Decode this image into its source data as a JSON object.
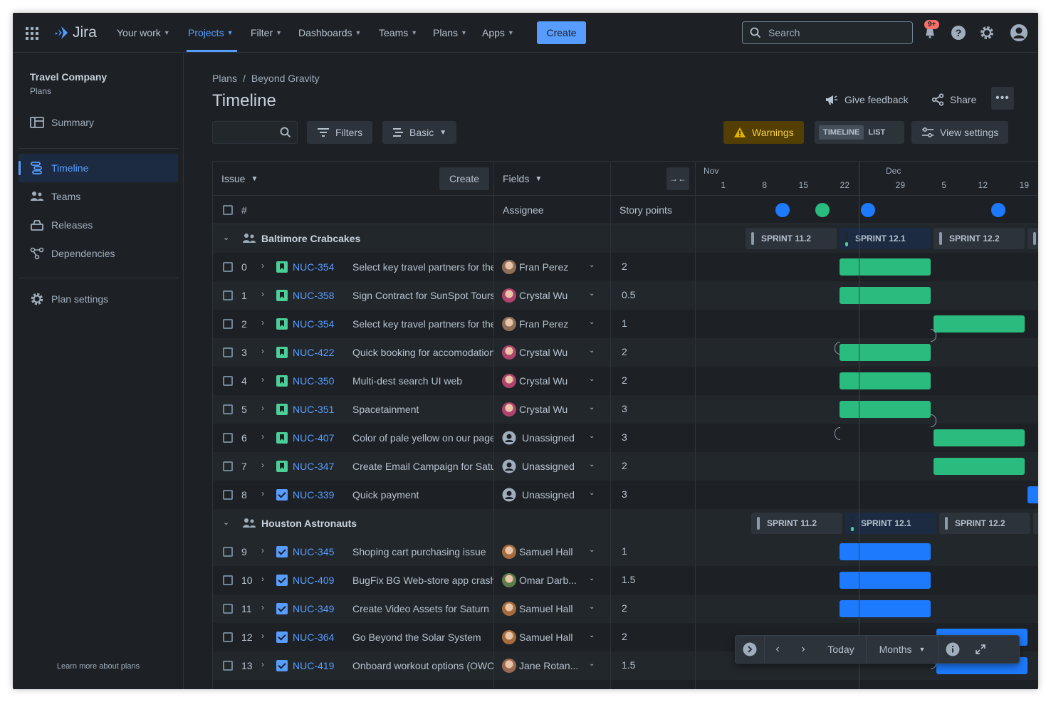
{
  "nav": {
    "product": "Jira",
    "items": [
      {
        "label": "Your work"
      },
      {
        "label": "Projects"
      },
      {
        "label": "Filter"
      },
      {
        "label": "Dashboards"
      },
      {
        "label": "Teams"
      },
      {
        "label": "Plans"
      },
      {
        "label": "Apps"
      }
    ],
    "create": "Create",
    "search_placeholder": "Search",
    "notif_badge": "9+"
  },
  "sidebar": {
    "project": "Travel Company",
    "subtitle": "Plans",
    "items": [
      {
        "label": "Summary",
        "icon": "summary-icon"
      },
      {
        "label": "Timeline",
        "icon": "timeline-icon"
      },
      {
        "label": "Teams",
        "icon": "teams-icon"
      },
      {
        "label": "Releases",
        "icon": "releases-icon"
      },
      {
        "label": "Dependencies",
        "icon": "dependencies-icon"
      }
    ],
    "settings": "Plan settings",
    "learn": "Learn more about plans"
  },
  "header": {
    "breadcrumb": [
      "Plans",
      "Beyond Gravity"
    ],
    "title": "Timeline",
    "feedback": "Give feedback",
    "share": "Share"
  },
  "toolbar": {
    "filters": "Filters",
    "basic": "Basic",
    "warnings": "Warnings",
    "timeline": "TIMELINE",
    "list": "LIST",
    "view_settings": "View settings"
  },
  "table": {
    "issue": "Issue",
    "create": "Create",
    "fields": "Fields",
    "num": "#",
    "assignee": "Assignee",
    "story_points": "Story points"
  },
  "timeline": {
    "months": [
      "Nov",
      "Dec"
    ],
    "ticks": [
      "1",
      "8",
      "15",
      "22",
      "29",
      "5",
      "12",
      "19"
    ]
  },
  "groups": [
    {
      "name": "Baltimore Crabcakes",
      "sprints": [
        "SPRINT 11.2",
        "SPRINT 12.1",
        "SPRINT 12.2"
      ],
      "rows": [
        {
          "n": "0",
          "key": "NUC-354",
          "summary": "Select key travel partners for the",
          "assignee": "Fran Perez",
          "sp": "2",
          "type": "story"
        },
        {
          "n": "1",
          "key": "NUC-358",
          "summary": "Sign Contract for SunSpot Tours",
          "assignee": "Crystal Wu",
          "sp": "0.5",
          "type": "story"
        },
        {
          "n": "2",
          "key": "NUC-354",
          "summary": "Select key travel partners for the",
          "assignee": "Fran Perez",
          "sp": "1",
          "type": "story"
        },
        {
          "n": "3",
          "key": "NUC-422",
          "summary": "Quick booking for accomodations",
          "assignee": "Crystal Wu",
          "sp": "2",
          "type": "story"
        },
        {
          "n": "4",
          "key": "NUC-350",
          "summary": "Multi-dest search UI web",
          "assignee": "Crystal Wu",
          "sp": "2",
          "type": "story"
        },
        {
          "n": "5",
          "key": "NUC-351",
          "summary": "Spacetainment",
          "assignee": "Crystal Wu",
          "sp": "3",
          "type": "story"
        },
        {
          "n": "6",
          "key": "NUC-407",
          "summary": "Color of pale yellow on our page",
          "assignee": "Unassigned",
          "sp": "3",
          "type": "story"
        },
        {
          "n": "7",
          "key": "NUC-347",
          "summary": "Create Email Campaign for Saturn",
          "assignee": "Unassigned",
          "sp": "2",
          "type": "story"
        },
        {
          "n": "8",
          "key": "NUC-339",
          "summary": "Quick payment",
          "assignee": "Unassigned",
          "sp": "3",
          "type": "task"
        }
      ]
    },
    {
      "name": "Houston Astronauts",
      "sprints": [
        "SPRINT 11.2",
        "SPRINT 12.1",
        "SPRINT 12.2"
      ],
      "rows": [
        {
          "n": "9",
          "key": "NUC-345",
          "summary": "Shoping cart purchasing issue",
          "assignee": "Samuel Hall",
          "sp": "1",
          "type": "task"
        },
        {
          "n": "10",
          "key": "NUC-409",
          "summary": "BugFix  BG Web-store app crash",
          "assignee": "Omar Darb...",
          "sp": "1.5",
          "type": "task"
        },
        {
          "n": "11",
          "key": "NUC-349",
          "summary": "Create Video Assets for Saturn",
          "assignee": "Samuel Hall",
          "sp": "2",
          "type": "task"
        },
        {
          "n": "12",
          "key": "NUC-364",
          "summary": "Go Beyond the Solar System",
          "assignee": "Samuel Hall",
          "sp": "2",
          "type": "task"
        },
        {
          "n": "13",
          "key": "NUC-419",
          "summary": "Onboard workout options (OWO)",
          "assignee": "Jane Rotan...",
          "sp": "1.5",
          "type": "task"
        }
      ]
    }
  ],
  "floating": {
    "today": "Today",
    "months": "Months"
  },
  "colors": {
    "accent": "#579dff",
    "green": "#2abb7f",
    "blue": "#1d7afc"
  }
}
